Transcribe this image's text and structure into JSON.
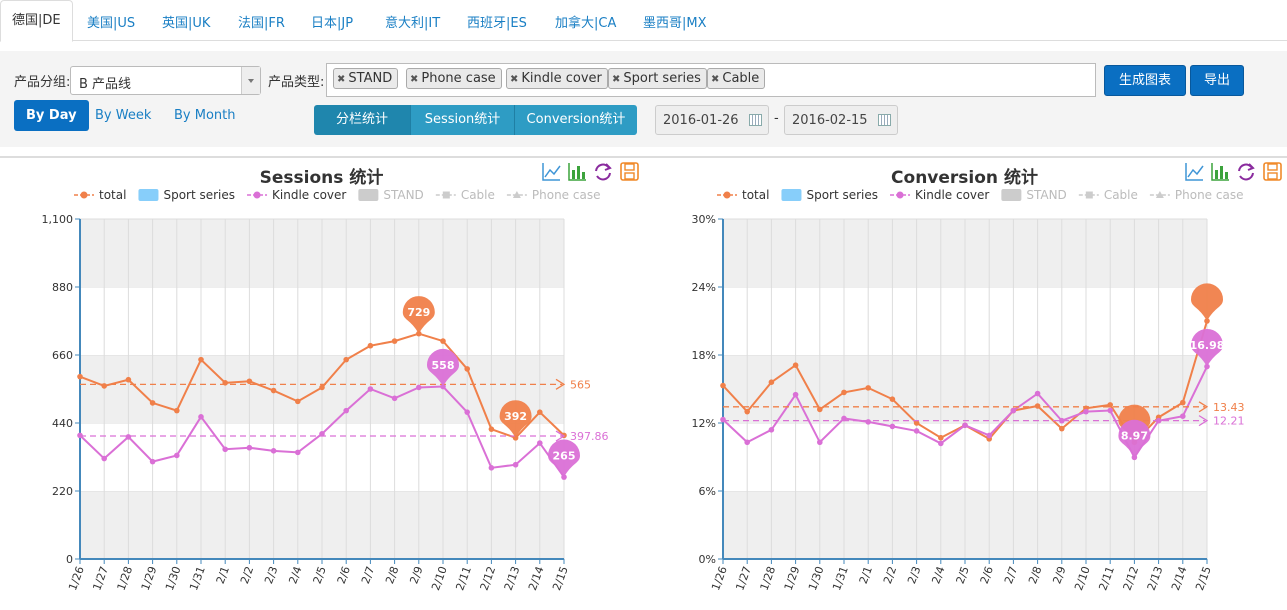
{
  "tabs": [
    {
      "label": "德国|DE",
      "active": true
    },
    {
      "label": "美国|US"
    },
    {
      "label": "英国|UK"
    },
    {
      "label": "法国|FR"
    },
    {
      "label": "日本|JP"
    },
    {
      "label": "意大利|IT"
    },
    {
      "label": "西班牙|ES"
    },
    {
      "label": "加拿大|CA"
    },
    {
      "label": "墨西哥|MX"
    }
  ],
  "filters": {
    "group_label": "产品分组",
    "group_value": "B 产品线",
    "type_label": "产品类型",
    "tags": [
      "STAND",
      "Phone case",
      "Kindle cover",
      "Sport series",
      "Cable"
    ],
    "generate_label": "生成图表",
    "export_label": "导出"
  },
  "periods": [
    "By Day",
    "By Week",
    "By Month"
  ],
  "segments": [
    "分栏统计",
    "Session统计",
    "Conversion统计"
  ],
  "dates": {
    "start": "2016-01-26",
    "sep": "-",
    "end": "2016-02-15"
  },
  "colors": {
    "total": "#f0804a",
    "sport": "#87cefa",
    "kindle": "#da70d6",
    "off": "#cccccc",
    "accent": "#0a6fc2"
  },
  "legend": [
    {
      "name": "total",
      "style": "line-dot",
      "color": "#f0804a"
    },
    {
      "name": "Sport series",
      "style": "box",
      "color": "#87cefa"
    },
    {
      "name": "Kindle cover",
      "style": "line-dot",
      "color": "#da70d6"
    },
    {
      "name": "STAND",
      "style": "box-off",
      "color": "#cccccc"
    },
    {
      "name": "Cable",
      "style": "line-square-off",
      "color": "#cccccc"
    },
    {
      "name": "Phone case",
      "style": "line-triangle-off",
      "color": "#cccccc"
    }
  ],
  "toolbar_icons": [
    "line-chart-icon",
    "bar-chart-icon",
    "refresh-icon",
    "save-icon"
  ],
  "chart_data": [
    {
      "type": "line",
      "title": "Sessions 统计",
      "categories": [
        "1/26",
        "1/27",
        "1/28",
        "1/29",
        "1/30",
        "1/31",
        "2/1",
        "2/2",
        "2/3",
        "2/4",
        "2/5",
        "2/6",
        "2/7",
        "2/8",
        "2/9",
        "2/10",
        "2/11",
        "2/12",
        "2/13",
        "2/14",
        "2/15"
      ],
      "y_ticks": [
        "0",
        "220",
        "440",
        "660",
        "880",
        "1,100"
      ],
      "ylim": [
        0,
        1100
      ],
      "series": [
        {
          "name": "total",
          "values": [
            590,
            560,
            580,
            505,
            480,
            645,
            570,
            575,
            545,
            510,
            555,
            645,
            690,
            705,
            729,
            705,
            615,
            420,
            392,
            475,
            400
          ],
          "max": {
            "index": 14,
            "label": "729"
          },
          "min": {
            "index": 18,
            "label": "392"
          },
          "average": {
            "value": 565,
            "label": "565"
          }
        },
        {
          "name": "Kindle cover",
          "values": [
            400,
            325,
            395,
            315,
            335,
            460,
            355,
            360,
            350,
            345,
            405,
            480,
            550,
            520,
            555,
            558,
            475,
            295,
            305,
            375,
            265
          ],
          "max": {
            "index": 15,
            "label": "558"
          },
          "min": {
            "index": 20,
            "label": "265"
          },
          "average": {
            "value": 397.86,
            "label": "397.86"
          }
        }
      ]
    },
    {
      "type": "line",
      "title": "Conversion 统计",
      "categories": [
        "1/26",
        "1/27",
        "1/28",
        "1/29",
        "1/30",
        "1/31",
        "2/1",
        "2/2",
        "2/3",
        "2/4",
        "2/5",
        "2/6",
        "2/7",
        "2/8",
        "2/9",
        "2/10",
        "2/11",
        "2/12",
        "2/13",
        "2/14",
        "2/15"
      ],
      "y_ticks": [
        "0%",
        "6%",
        "12%",
        "18%",
        "24%",
        "30%"
      ],
      "ylim": [
        0,
        30
      ],
      "series": [
        {
          "name": "total",
          "values": [
            15.3,
            13.0,
            15.6,
            17.1,
            13.2,
            14.7,
            15.1,
            14.1,
            12.0,
            10.7,
            11.8,
            10.6,
            13.1,
            13.5,
            11.5,
            13.3,
            13.6,
            10.3,
            12.5,
            13.8,
            21.0
          ],
          "max": {
            "index": 20,
            "label": ""
          },
          "min": {
            "index": 17,
            "label": ""
          },
          "average": {
            "value": 13.43,
            "label": "13.43"
          }
        },
        {
          "name": "Kindle cover",
          "values": [
            12.3,
            10.3,
            11.4,
            14.5,
            10.3,
            12.4,
            12.1,
            11.7,
            11.3,
            10.2,
            11.8,
            10.9,
            13.1,
            14.6,
            12.2,
            13.0,
            13.1,
            8.97,
            12.2,
            12.6,
            16.98
          ],
          "max": {
            "index": 20,
            "label": "16.98"
          },
          "min": {
            "index": 17,
            "label": "8.97"
          },
          "average": {
            "value": 12.21,
            "label": "12.21"
          }
        }
      ]
    }
  ]
}
